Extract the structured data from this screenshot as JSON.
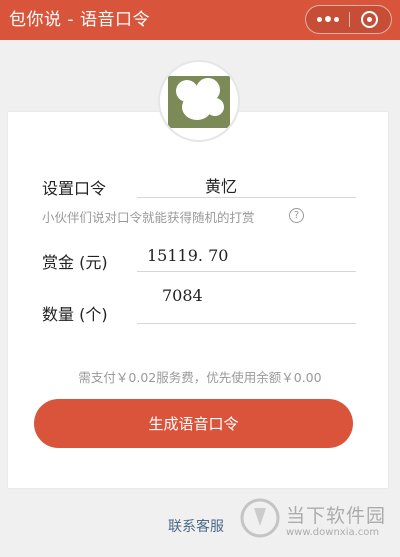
{
  "header": {
    "title": "包你说 - 语音口令",
    "more_icon": "more-dots-icon",
    "close_icon": "miniprogram-close-icon",
    "background_color": "#d8553b"
  },
  "avatar": {
    "icon": "user-avatar"
  },
  "form": {
    "password": {
      "label": "设置口令",
      "value": "黄忆"
    },
    "hint": "小伙伴们说对口令就能获得随机的打赏",
    "hint_icon": "question-circle-icon",
    "reward": {
      "label": "赏金 (元)",
      "value": "15119. 70"
    },
    "quantity": {
      "label": "数量 (个)",
      "value": "7084"
    }
  },
  "fee_note": "需支付￥0.02服务费，优先使用余额￥0.00",
  "generate_button": {
    "label": "生成语音口令",
    "color": "#d9543a"
  },
  "contact_link": "联系客服",
  "watermark": {
    "name": "当下软件园",
    "url": "www.downxia.com"
  }
}
